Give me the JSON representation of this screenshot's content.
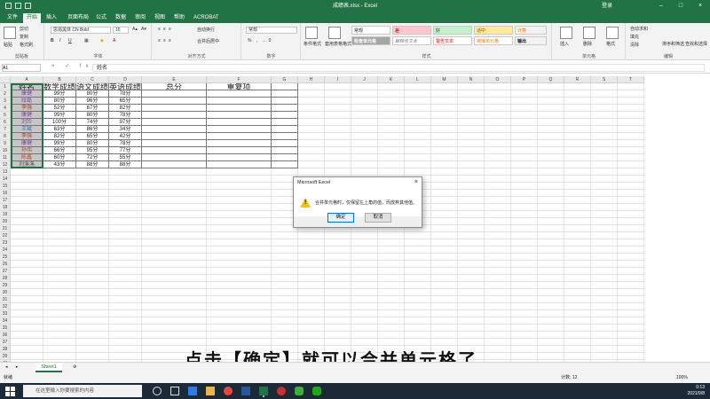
{
  "window": {
    "title": "成绩表.xlsx  -  Excel",
    "account": "登录"
  },
  "ribbon_tabs": [
    "文件",
    "开始",
    "插入",
    "页面布局",
    "公式",
    "数据",
    "审阅",
    "视图",
    "帮助",
    "ACROBAT"
  ],
  "ribbon": {
    "clipboard": {
      "label": "剪贴板",
      "paste": "粘贴",
      "cut": "剪切",
      "copy": "复制",
      "format_painter": "格式刷"
    },
    "font": {
      "label": "字体",
      "name": "思源黑体 CN Bold",
      "size": "16"
    },
    "alignment": {
      "label": "对齐方式",
      "wrap": "自动换行",
      "merge": "合并后居中"
    },
    "number": {
      "label": "数字",
      "format": "常规"
    },
    "styles": {
      "label": "样式",
      "cond_format": "条件格式",
      "table_format": "套用表格格式",
      "cells": [
        "常规",
        "差",
        "好",
        "适中",
        "计算",
        "检查单元格",
        "解释性文本",
        "警告文本",
        "链接单元格",
        "输出"
      ]
    },
    "cells_group": {
      "label": "单元格",
      "insert": "插入",
      "delete": "删除",
      "format": "格式"
    },
    "editing": {
      "label": "编辑",
      "autosum": "自动求和",
      "fill": "填充",
      "clear": "清除",
      "sort": "排序和筛选",
      "find": "查找和选择"
    }
  },
  "formula_bar": {
    "name_box": "A1",
    "formula": "姓名"
  },
  "columns": [
    "A",
    "B",
    "C",
    "D",
    "E",
    "F",
    "G",
    "H",
    "I",
    "J",
    "K",
    "L",
    "M",
    "N",
    "O",
    "P",
    "Q",
    "R",
    "S",
    "T"
  ],
  "row_numbers": [
    "1",
    "2",
    "3",
    "4",
    "5",
    "6",
    "7",
    "8",
    "9",
    "10",
    "11",
    "12",
    "13",
    "14",
    "15",
    "16",
    "17",
    "18",
    "19",
    "20",
    "21",
    "22",
    "23",
    "24",
    "25",
    "26",
    "27",
    "28",
    "29",
    "30",
    "31",
    "32",
    "33",
    "34",
    "35",
    "36",
    "37",
    "38",
    "39",
    "40"
  ],
  "table": {
    "headers": [
      "姓名",
      "数学成绩",
      "语文成绩",
      "英语成绩",
      "总分",
      "重复项"
    ],
    "rows": [
      {
        "name": "康健",
        "math": "99分",
        "chinese": "80分",
        "english": "78分"
      },
      {
        "name": "段磊",
        "math": "80分",
        "chinese": "96分",
        "english": "65分"
      },
      {
        "name": "李强",
        "math": "52分",
        "chinese": "67分",
        "english": "82分"
      },
      {
        "name": "康健",
        "math": "99分",
        "chinese": "80分",
        "english": "78分"
      },
      {
        "name": "刘玲",
        "math": "100分",
        "chinese": "74分",
        "english": "97分"
      },
      {
        "name": "王斌",
        "math": "63分",
        "chinese": "86分",
        "english": "34分"
      },
      {
        "name": "李强",
        "math": "82分",
        "chinese": "65分",
        "english": "42分"
      },
      {
        "name": "康健",
        "math": "99分",
        "chinese": "80分",
        "english": "78分"
      },
      {
        "name": "孙伟",
        "math": "66分",
        "chinese": "95分",
        "english": "77分"
      },
      {
        "name": "陈鑫",
        "math": "60分",
        "chinese": "72分",
        "english": "55分"
      },
      {
        "name": "刘溪溪",
        "math": "43分",
        "chinese": "88分",
        "english": "88分"
      }
    ],
    "name_colors": [
      "#7d3f9a",
      "#7d3f9a",
      "#b03a2e",
      "#7d3f9a",
      "#7d3f9a",
      "#2e6fb5",
      "#b03a2e",
      "#7d3f9a",
      "#c23b22",
      "#c23b22",
      "#555555"
    ]
  },
  "dialog": {
    "title": "Microsoft Excel",
    "message": "合并单元格时，仅保留左上角的值，而放弃其他值。",
    "ok": "确定",
    "cancel": "取消"
  },
  "subtitle": "点击【确定】就可以合并单元格了",
  "sheet_tabs": [
    "Sheet1"
  ],
  "status": {
    "mode": "就绪",
    "count": "计数: 12",
    "zoom": "100%"
  },
  "taskbar": {
    "search_placeholder": "在这里输入你要搜索的内容",
    "time": "0:13",
    "date": "2021/9/8"
  },
  "colors": {
    "excel_green": "#217346",
    "selection": "#c6c6c6",
    "warning": "#f4c20d"
  }
}
